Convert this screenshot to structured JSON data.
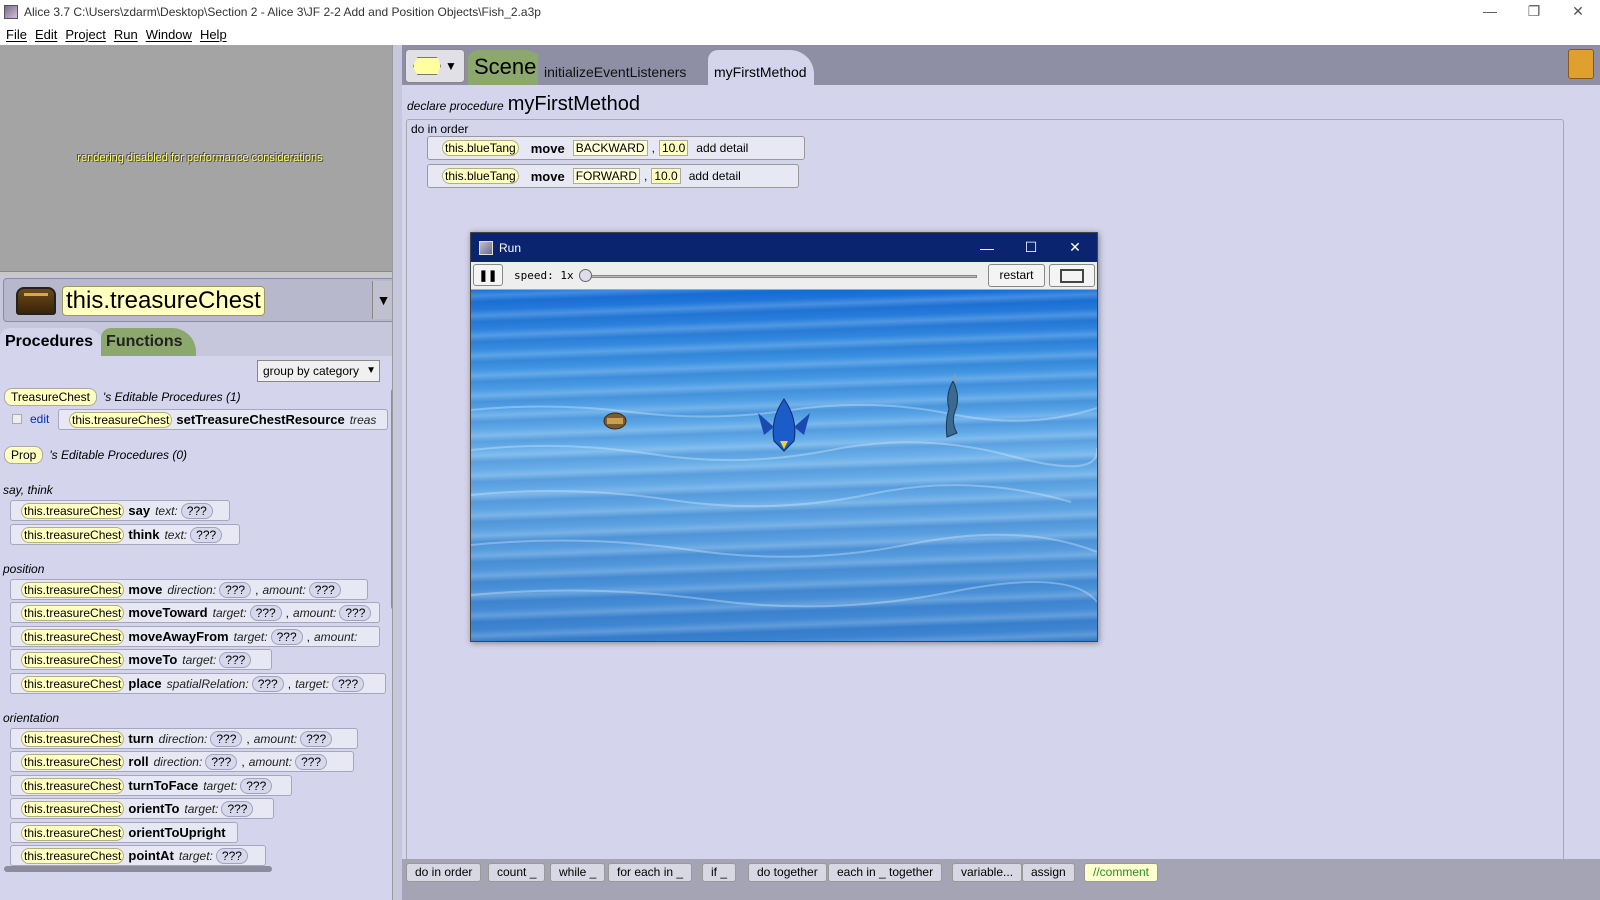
{
  "window": {
    "title": "Alice 3.7 C:\\Users\\zdarm\\Desktop\\Section 2 - Alice 3\\JF 2-2 Add and Position Objects\\Fish_2.a3p",
    "min": "—",
    "max": "❐",
    "close": "✕"
  },
  "menu": [
    "File",
    "Edit",
    "Project",
    "Run",
    "Window",
    "Help"
  ],
  "preview": {
    "message": "rendering disabled for performance considerations"
  },
  "selector": {
    "name": "this.treasureChest",
    "arrow": "▼"
  },
  "palette_tabs": {
    "procedures": "Procedures",
    "functions": "Functions"
  },
  "group_by": "group by category",
  "editable": {
    "class1": "TreasureChest",
    "class1_text": "'s Editable Procedures (1)",
    "edit": "edit",
    "class2": "Prop",
    "class2_text": "'s Editable Procedures (0)"
  },
  "receiver": "this.treasureChest",
  "receiver_short": "this.treasureChest",
  "q": "???",
  "categories": {
    "say": "say, think",
    "position": "position",
    "orientation": "orientation"
  },
  "methods": {
    "setResource": "setTreasureChestResource",
    "setResource_arg": "treas",
    "say": "say",
    "think": "think",
    "text": "text:",
    "move": "move",
    "moveToward": "moveToward",
    "moveAwayFrom": "moveAwayFrom",
    "moveTo": "moveTo",
    "place": "place",
    "turn": "turn",
    "roll": "roll",
    "turnToFace": "turnToFace",
    "orientTo": "orientTo",
    "orientToUpright": "orientToUpright",
    "pointAt": "pointAt",
    "direction": "direction:",
    "amount": "amount:",
    "target": "target:",
    "spatialRelation": "spatialRelation:"
  },
  "editor": {
    "tab_scene": "Scene",
    "tab_init": "initializeEventListeners",
    "tab_method": "myFirstMethod",
    "declare_kw": "declare procedure",
    "proc_name": "myFirstMethod",
    "do_in_order": "do in order",
    "statements": [
      {
        "receiver": "this.blueTang",
        "method": "move",
        "direction": "BACKWARD",
        "amount": "10.0",
        "detail": "add detail"
      },
      {
        "receiver": "this.blueTang",
        "method": "move",
        "direction": "FORWARD",
        "amount": "10.0",
        "detail": "add detail"
      }
    ]
  },
  "toolbar": [
    "do in order",
    "count _",
    "while _",
    "for each in _",
    "if _",
    "do together",
    "each in _ together",
    "variable...",
    "assign",
    "//comment"
  ],
  "run": {
    "title": "Run",
    "speed": "speed: 1x",
    "speed_value": 1,
    "restart": "restart"
  },
  "colors": {
    "palette_bg": "#d4d4ec",
    "scene_tab": "#8ca86c",
    "run_title_bg": "#0a2470",
    "receiver_chip": "#ffffc0"
  }
}
